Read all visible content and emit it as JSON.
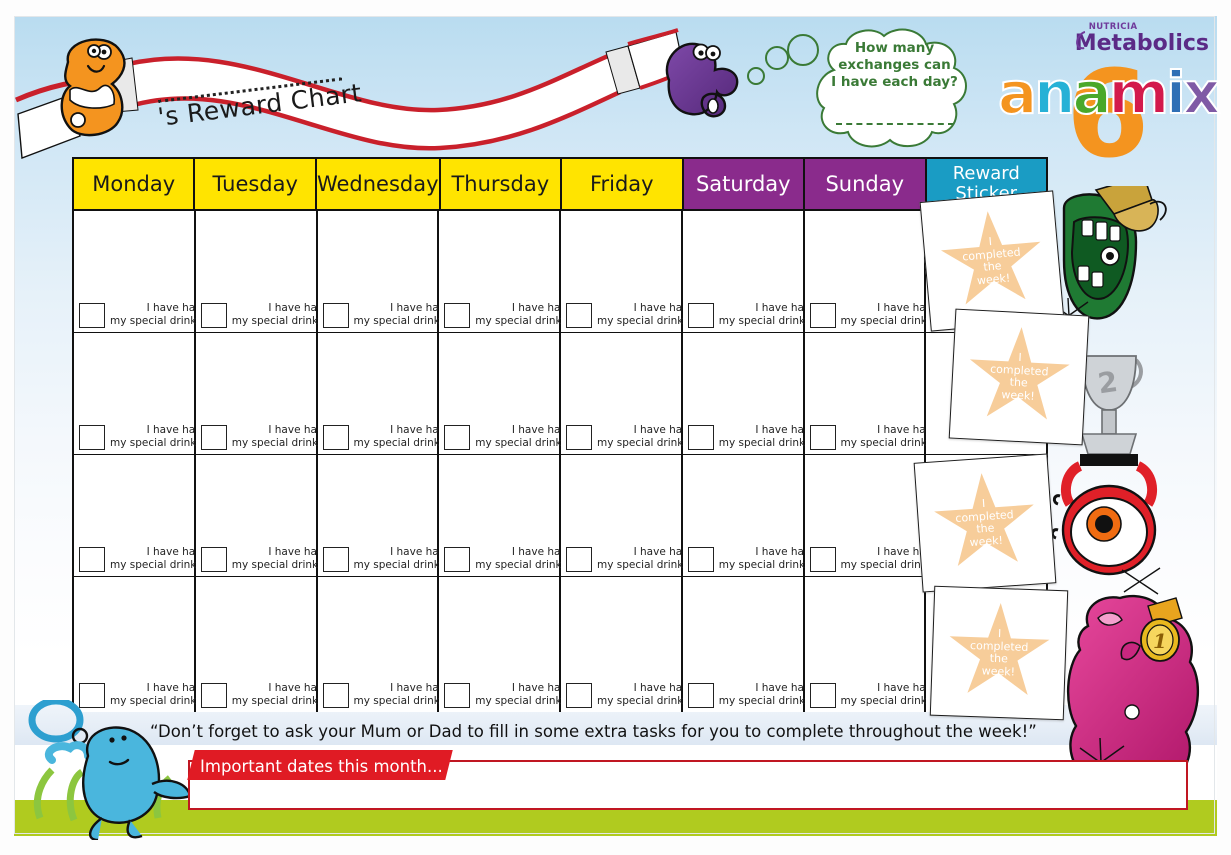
{
  "brand": {
    "nutricia_small": "NUTRICIA",
    "nutricia_big": "Metabolics",
    "product_letters": [
      "a",
      "n",
      "a",
      "m",
      "i",
      "x"
    ],
    "product_colors": [
      "#f4941f",
      "#26b1d6",
      "#4aa82a",
      "#d31a4c",
      "#2f6fb5",
      "#7f5aa5"
    ],
    "product_number": "6"
  },
  "banner": {
    "title_suffix": "'s Reward Chart",
    "dotted_name_line": ""
  },
  "bubble": {
    "line1": "How many",
    "line2": "exchanges can",
    "line3": "I have each day?",
    "answer_blank": "",
    "color": "#3a7a36"
  },
  "calendar": {
    "headers": [
      {
        "label": "Monday",
        "bg": "#ffe400",
        "type": "weekday"
      },
      {
        "label": "Tuesday",
        "bg": "#ffe400",
        "type": "weekday"
      },
      {
        "label": "Wednesday",
        "bg": "#ffe400",
        "type": "weekday"
      },
      {
        "label": "Thursday",
        "bg": "#ffe400",
        "type": "weekday"
      },
      {
        "label": "Friday",
        "bg": "#ffe400",
        "type": "weekday"
      },
      {
        "label": "Saturday",
        "bg": "#8a2b8c",
        "type": "weekend"
      },
      {
        "label": "Sunday",
        "bg": "#8a2b8c",
        "type": "weekend"
      },
      {
        "label": "Reward\nSticker",
        "bg": "#1a9cc4",
        "type": "reward"
      }
    ],
    "rows": 4,
    "columns": 8,
    "task_label_line1": "I have had",
    "task_label_line2": "my special drinks",
    "checkbox_checked": false
  },
  "stickers": [
    {
      "line1": "I",
      "line2": "completed",
      "line3": "the",
      "line4": "week!"
    },
    {
      "line1": "I",
      "line2": "completed",
      "line3": "the",
      "line4": "week!"
    },
    {
      "line1": "I",
      "line2": "completed",
      "line3": "the",
      "line4": "week!"
    },
    {
      "line1": "I",
      "line2": "completed",
      "line3": "the",
      "line4": "week!"
    }
  ],
  "footer": {
    "quote": "“Don’t forget to ask your Mum or Dad to fill in some extra tasks for you to complete throughout the week!”",
    "dates_ribbon": "Important dates this month...",
    "dates_value": ""
  },
  "colors": {
    "weekday_yellow": "#ffe400",
    "weekend_purple": "#8a2b8c",
    "reward_blue": "#1a9cc4",
    "ribbon_red": "#e01b24",
    "grass_green": "#b0cb1f",
    "star_peach": "#f7cd9a",
    "sky_blue": "#b9dcf0"
  },
  "characters": [
    {
      "name": "orange-blob-character",
      "color": "#f4941f"
    },
    {
      "name": "purple-squiggle-character",
      "color": "#6c3a93"
    },
    {
      "name": "green-mouth-monster",
      "color": "#1f7a33"
    },
    {
      "name": "red-eyeball-character",
      "color": "#e02028"
    },
    {
      "name": "pink-monster-character",
      "color": "#d62b86"
    },
    {
      "name": "blue-blob-character",
      "color": "#4ab6dd"
    },
    {
      "name": "gold-trophy",
      "color": "#c9a33b"
    },
    {
      "name": "silver-trophy",
      "color": "#b9bcc0",
      "number": "2"
    },
    {
      "name": "gold-medal",
      "color": "#e8b81e",
      "number": "1"
    }
  ]
}
